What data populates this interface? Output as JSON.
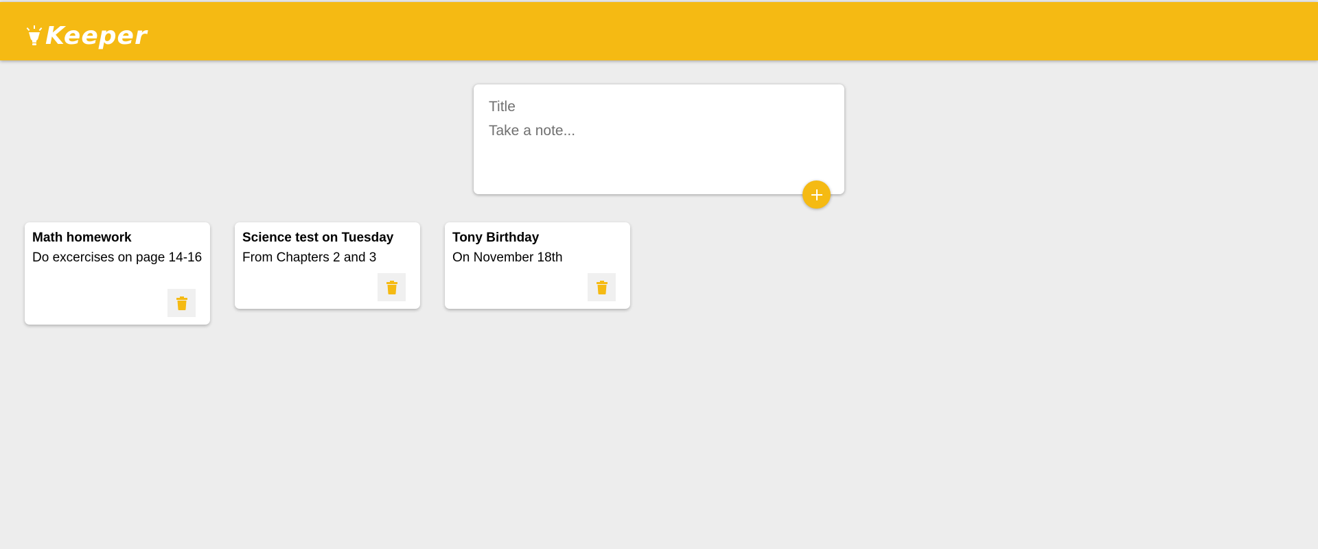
{
  "header": {
    "logo_text": "Keeper",
    "logo_icon": "lightbulb-icon",
    "background_color": "#f5ba13"
  },
  "create_note": {
    "title_placeholder": "Title",
    "content_placeholder": "Take a note...",
    "title_value": "",
    "content_value": "",
    "add_icon": "plus-icon"
  },
  "notes": [
    {
      "title": "Math homework",
      "content": "Do excercises on page 14-16",
      "delete_icon": "trash-icon"
    },
    {
      "title": "Science test on Tuesday",
      "content": "From Chapters 2 and 3",
      "delete_icon": "trash-icon"
    },
    {
      "title": "Tony Birthday",
      "content": "On November 18th",
      "delete_icon": "trash-icon"
    }
  ],
  "colors": {
    "accent": "#f5ba13",
    "background": "#ededed",
    "card": "#ffffff"
  }
}
